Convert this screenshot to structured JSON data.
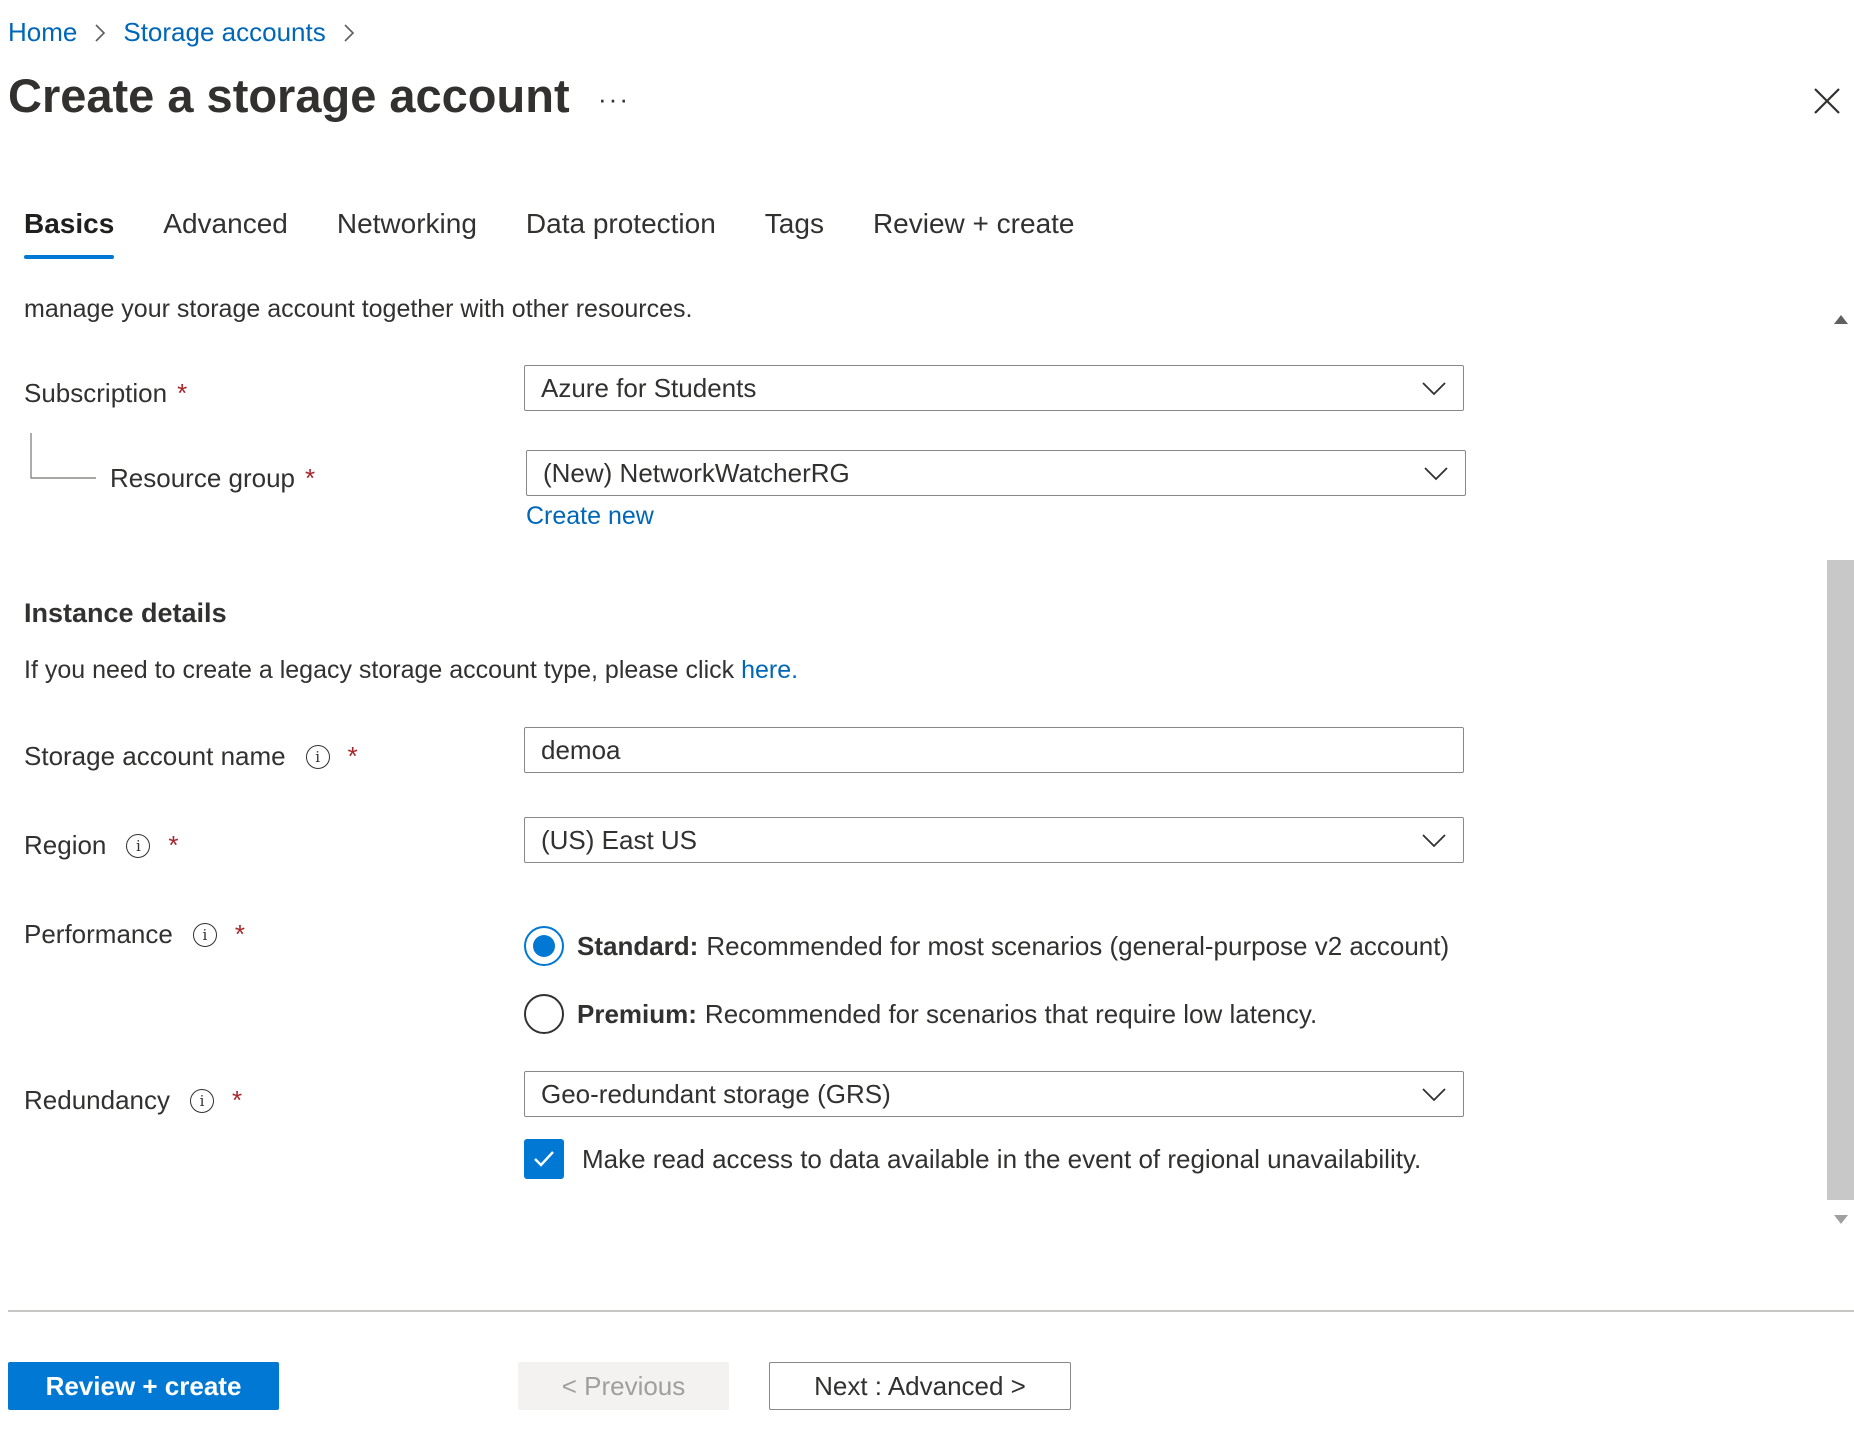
{
  "breadcrumb": {
    "home": "Home",
    "storage_accounts": "Storage accounts"
  },
  "header": {
    "title": "Create a storage account",
    "more_label": "···"
  },
  "tabs": [
    {
      "label": "Basics",
      "active": true
    },
    {
      "label": "Advanced",
      "active": false
    },
    {
      "label": "Networking",
      "active": false
    },
    {
      "label": "Data protection",
      "active": false
    },
    {
      "label": "Tags",
      "active": false
    },
    {
      "label": "Review + create",
      "active": false
    }
  ],
  "project": {
    "intro_tail": "manage your storage account together with other resources.",
    "subscription_label": "Subscription",
    "subscription_value": "Azure for Students",
    "resource_group_label": "Resource group",
    "resource_group_value": "(New) NetworkWatcherRG",
    "create_new": "Create new"
  },
  "instance": {
    "heading": "Instance details",
    "legacy_text": "If you need to create a legacy storage account type, please click ",
    "legacy_link": "here.",
    "name_label": "Storage account name",
    "name_value": "demoa",
    "region_label": "Region",
    "region_value": "(US) East US",
    "performance_label": "Performance",
    "performance_options": [
      {
        "title": "Standard:",
        "desc": "Recommended for most scenarios (general-purpose v2 account)",
        "selected": true
      },
      {
        "title": "Premium:",
        "desc": "Recommended for scenarios that require low latency.",
        "selected": false
      }
    ],
    "redundancy_label": "Redundancy",
    "redundancy_value": "Geo-redundant storage (GRS)",
    "read_access_label": "Make read access to data available in the event of regional unavailability.",
    "read_access_checked": true
  },
  "required_mark": "*",
  "info_glyph": "i",
  "footer": {
    "review_create": "Review + create",
    "previous": "< Previous",
    "next": "Next : Advanced >"
  },
  "colors": {
    "accent": "#0078d4",
    "link": "#0067b8",
    "required": "#a4262c"
  }
}
